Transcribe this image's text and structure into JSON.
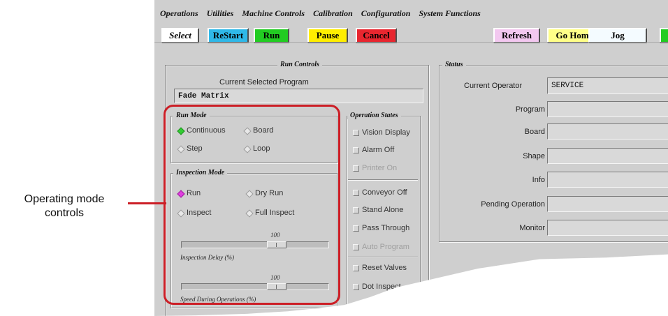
{
  "menu": [
    "Operations",
    "Utilities",
    "Machine Controls",
    "Calibration",
    "Configuration",
    "System Functions"
  ],
  "toolbar": {
    "select": "Select",
    "restart": "ReStart",
    "run": "Run",
    "pause": "Pause",
    "cancel": "Cancel",
    "refresh": "Refresh",
    "go_home": "Go Home",
    "jog": "Jog"
  },
  "colors": {
    "select": "#ffffff",
    "restart": "#2fb8e8",
    "run": "#22cc22",
    "pause": "#ffee00",
    "cancel": "#e8262f",
    "refresh": "#f3c8f0",
    "go_home": "#ffff88",
    "jog": "#f4fbff",
    "extra": "#22cc22",
    "annotation": "#cc1e26"
  },
  "run_controls": {
    "title": "Run Controls",
    "current_program_label": "Current Selected Program",
    "current_program_value": "Fade Matrix",
    "run_mode": {
      "title": "Run Mode",
      "options": [
        "Continuous",
        "Board",
        "Step",
        "Loop"
      ],
      "selected": "Continuous"
    },
    "inspection_mode": {
      "title": "Inspection Mode",
      "options": [
        "Run",
        "Dry Run",
        "Inspect",
        "Full Inspect"
      ],
      "selected": "Run"
    },
    "inspection_delay": {
      "value": "100",
      "label": "Inspection Delay (%)"
    },
    "speed": {
      "value": "100",
      "label": "Speed During Operations (%)"
    }
  },
  "operation_states": {
    "title": "Operation States",
    "group1": [
      "Vision Display",
      "Alarm Off",
      "Printer On"
    ],
    "group2": [
      "Conveyor Off",
      "Stand Alone",
      "Pass Through",
      "Auto Program"
    ],
    "group3": [
      "Reset Valves",
      "Dot Inspect"
    ]
  },
  "status": {
    "title": "Status",
    "current_operator_label": "Current Operator",
    "current_operator_value": "SERVICE",
    "fields": [
      "Program",
      "Board",
      "Shape",
      "Info",
      "Pending Operation",
      "Monitor"
    ]
  },
  "annotation": {
    "line1": "Operating mode",
    "line2": "controls"
  }
}
